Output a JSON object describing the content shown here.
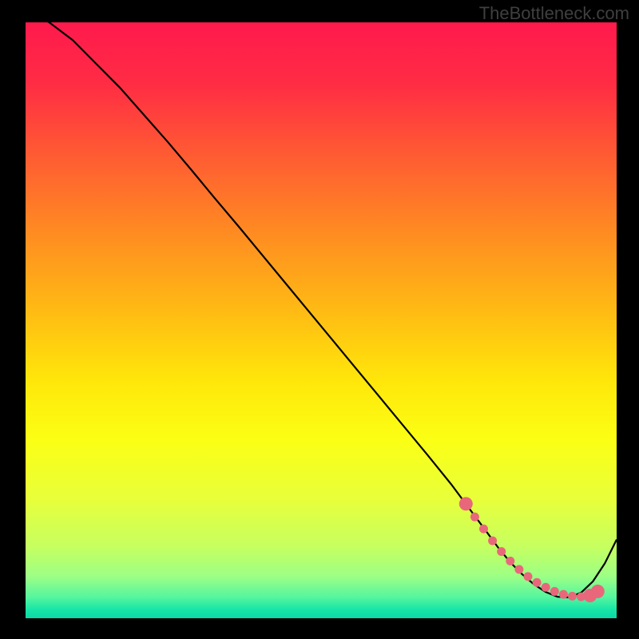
{
  "watermark": "TheBottleneck.com",
  "chart_data": {
    "type": "line",
    "title": "",
    "xlabel": "",
    "ylabel": "",
    "xlim": [
      0,
      100
    ],
    "ylim": [
      0,
      100
    ],
    "series": [
      {
        "name": "curve",
        "x": [
          0,
          4,
          8,
          12,
          16,
          20,
          24,
          28,
          32,
          36,
          40,
          44,
          48,
          52,
          56,
          60,
          64,
          68,
          72,
          75,
          78,
          80,
          82,
          84,
          86,
          88,
          90,
          92,
          94,
          96,
          98,
          100
        ],
        "y": [
          102,
          100,
          97,
          93,
          89,
          84.5,
          80,
          75.3,
          70.5,
          65.8,
          61,
          56.2,
          51.4,
          46.6,
          41.8,
          37,
          32.2,
          27.4,
          22.5,
          18.5,
          14.5,
          11.8,
          9.4,
          7.4,
          5.7,
          4.4,
          3.6,
          3.5,
          4.3,
          6.2,
          9.2,
          13.2
        ]
      }
    ],
    "markers": {
      "name": "highlight",
      "x": [
        74.5,
        76,
        77.5,
        79,
        80.5,
        82,
        83.5,
        85,
        86.5,
        88,
        89.5,
        91,
        92.5,
        94,
        95.5
      ],
      "y": [
        19.2,
        17.0,
        15.0,
        13.0,
        11.2,
        9.6,
        8.2,
        7.0,
        6.0,
        5.2,
        4.5,
        4.0,
        3.7,
        3.6,
        3.8
      ],
      "big_x": [
        74.5,
        95.5,
        96.8
      ],
      "big_y": [
        19.2,
        3.8,
        4.5
      ]
    },
    "gradient_stops": [
      {
        "offset": 0.0,
        "color": "#ff1a4d"
      },
      {
        "offset": 0.1,
        "color": "#ff2b44"
      },
      {
        "offset": 0.22,
        "color": "#ff5a33"
      },
      {
        "offset": 0.35,
        "color": "#ff8a22"
      },
      {
        "offset": 0.48,
        "color": "#ffb914"
      },
      {
        "offset": 0.6,
        "color": "#ffe60a"
      },
      {
        "offset": 0.7,
        "color": "#fbff14"
      },
      {
        "offset": 0.8,
        "color": "#e8ff3a"
      },
      {
        "offset": 0.88,
        "color": "#c6ff60"
      },
      {
        "offset": 0.93,
        "color": "#9cff85"
      },
      {
        "offset": 0.965,
        "color": "#55f59f"
      },
      {
        "offset": 0.985,
        "color": "#18e6a6"
      },
      {
        "offset": 1.0,
        "color": "#0ad9a6"
      }
    ]
  }
}
